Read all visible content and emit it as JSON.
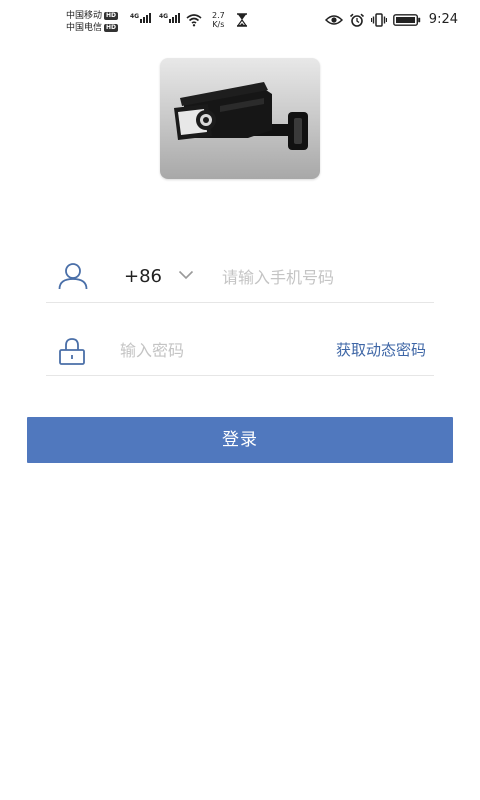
{
  "status_bar": {
    "carrier_1": "中国移动",
    "carrier_2": "中国电信",
    "hd_label": "HD",
    "network_1": "4G",
    "network_2": "4G",
    "net_speed_value": "2.7",
    "net_speed_unit": "K/s",
    "time": "9:24",
    "icons": [
      "eye-icon",
      "alarm-icon",
      "vibrate-icon",
      "battery-icon",
      "wifi-icon",
      "hourglass-icon"
    ]
  },
  "logo": {
    "icon": "security-camera-icon"
  },
  "login_form": {
    "phone_row": {
      "icon": "user-icon",
      "country_code": "+86",
      "dropdown_icon": "chevron-down-icon",
      "phone_value": "",
      "phone_placeholder": "请输入手机号码"
    },
    "password_row": {
      "icon": "lock-icon",
      "password_value": "",
      "password_placeholder": "输入密码",
      "dynamic_password_link": "获取动态密码"
    },
    "login_button": "登录"
  },
  "colors": {
    "accent": "#5078be",
    "link": "#3e66a6",
    "icon": "#4a6fa8",
    "divider": "#e6e6e6",
    "placeholder": "#c4c4c4"
  }
}
